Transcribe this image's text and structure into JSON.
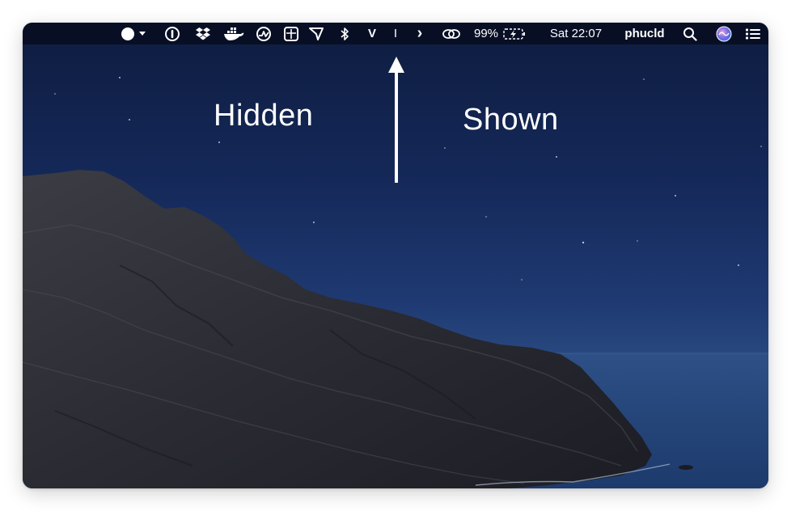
{
  "menubar": {
    "icons": [
      "cursor-toggle-icon",
      "onepassword-icon",
      "dropbox-icon",
      "docker-icon",
      "activity-monitor-icon",
      "grid-app-icon",
      "flag-icon",
      "bluetooth-icon",
      "vpn-v-icon",
      "divider-bar-icon",
      "chevron-right-icon",
      "link-icon",
      "battery-charging-icon",
      "search-icon",
      "siri-icon",
      "control-center-icon"
    ],
    "battery_percent": "99%",
    "clock": "Sat 22:07",
    "username": "phucld",
    "vpn_letter": "V",
    "divider_glyph": "I",
    "chevron_glyph": "›"
  },
  "annotations": {
    "hidden_label": "Hidden",
    "shown_label": "Shown"
  },
  "colors": {
    "sky_top": "#0e1c3f",
    "sky_bottom": "#2f5189",
    "menubar_bg": "#060c1e",
    "text": "#ffffff"
  }
}
